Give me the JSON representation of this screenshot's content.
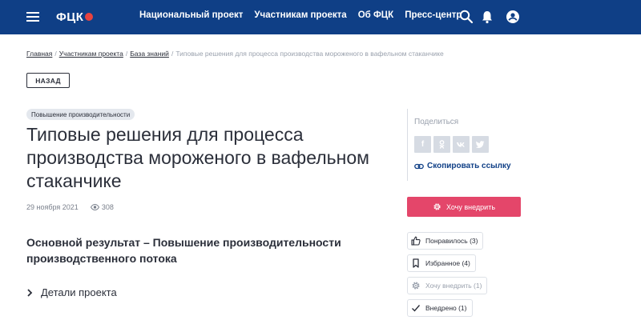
{
  "header": {
    "logo_text": "ФЦК",
    "nav": [
      "Национальный проект",
      "Участникам проекта",
      "Об ФЦК",
      "Пресс-центр"
    ]
  },
  "breadcrumb": {
    "items": [
      "Главная",
      "Участникам проекта",
      "База знаний"
    ],
    "current": "Типовые решения для процесса производства мороженого в вафельном стаканчике"
  },
  "back_label": "НАЗАД",
  "tag": "Повышение производительности",
  "title": "Типовые решения для процесса производства мороженого в вафельном стаканчике",
  "meta": {
    "date": "29 ноября 2021",
    "views": "308"
  },
  "result": "Основной результат – Повышение производительности производственного потока",
  "details_label": "Детали проекта",
  "share": {
    "label": "Поделиться",
    "facebook": "f",
    "copy_link": "Скопировать ссылку"
  },
  "want_button": "Хочу внедрить",
  "actions": {
    "liked": "Понравилось (3)",
    "favorites": "Избранное (4)",
    "want": "Хочу внедрить (1)",
    "implemented": "Внедрено (1)"
  },
  "colors": {
    "header_bg": "#0f3f86",
    "accent": "#e4466a",
    "logo_mark": "#e8433f"
  }
}
